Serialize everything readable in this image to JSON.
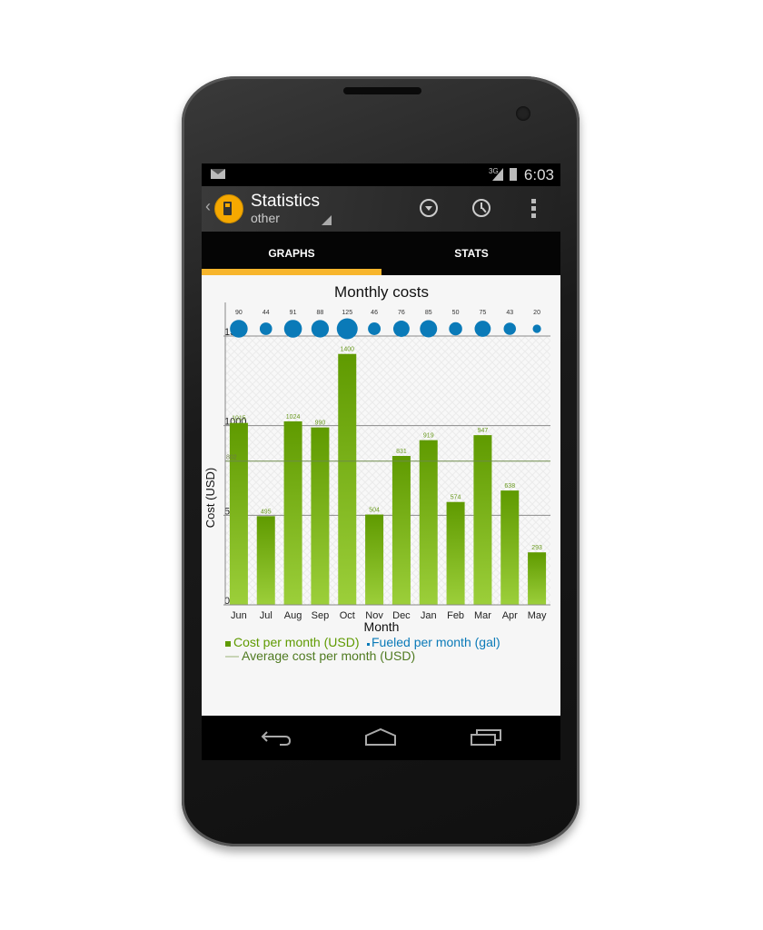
{
  "status_bar": {
    "time": "6:03",
    "network": "3G",
    "icons": [
      "mail-icon",
      "signal-icon",
      "battery-charging-icon"
    ]
  },
  "action_bar": {
    "title": "Statistics",
    "subtitle": "other",
    "icons": [
      "gas-pump-icon",
      "dropdown-circle-icon",
      "clock-icon",
      "overflow-menu-icon"
    ]
  },
  "tabs": [
    {
      "label": "GRAPHS",
      "active": true
    },
    {
      "label": "STATS",
      "active": false
    }
  ],
  "colors": {
    "accent": "#f7b52c",
    "cost": "#5f9a00",
    "fueled": "#0a7ab8",
    "average": "#6d8a4a"
  },
  "chart_data": {
    "type": "bar",
    "title": "Monthly costs",
    "xlabel": "Month",
    "ylabel": "Cost (USD)",
    "ylim": [
      0,
      1500
    ],
    "yticks": [
      0,
      500,
      1000,
      1500
    ],
    "grid": true,
    "categories": [
      "Jun",
      "Jul",
      "Aug",
      "Sep",
      "Oct",
      "Nov",
      "Dec",
      "Jan",
      "Feb",
      "Mar",
      "Apr",
      "May"
    ],
    "series": [
      {
        "name": "Cost per month (USD)",
        "type": "bar",
        "values": [
          1015,
          495,
          1024,
          990,
          1400,
          504,
          831,
          919,
          574,
          947,
          638,
          293
        ]
      },
      {
        "name": "Fueled per month (gal)",
        "type": "bubble",
        "values": [
          90,
          44,
          91,
          88,
          125,
          46,
          76,
          85,
          50,
          75,
          43,
          20
        ]
      },
      {
        "name": "Average cost per month (USD)",
        "type": "line",
        "value": 802
      }
    ],
    "legend": "bottom-left"
  },
  "navigation": {
    "icons": [
      "back-icon",
      "home-icon",
      "recent-apps-icon"
    ]
  }
}
